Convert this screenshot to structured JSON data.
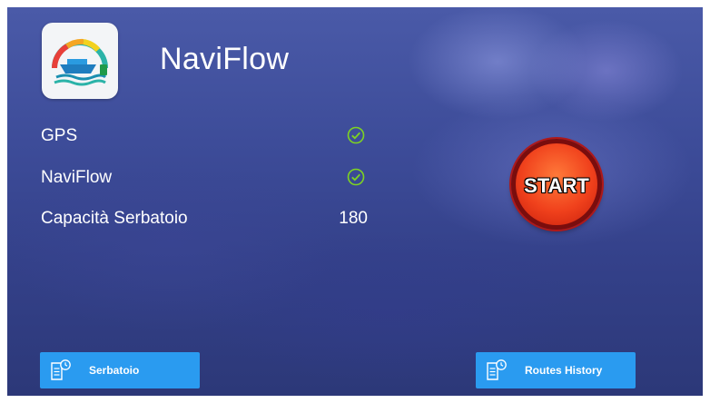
{
  "app": {
    "title": "NaviFlow",
    "icon": "boat-fuel-gauge-icon"
  },
  "status_rows": [
    {
      "label": "GPS",
      "status": "ok",
      "icon": "check-circle-icon"
    },
    {
      "label": "NaviFlow",
      "status": "ok",
      "icon": "check-circle-icon"
    },
    {
      "label": "Capacità Serbatoio",
      "value": "180"
    }
  ],
  "start_button": {
    "label": "START"
  },
  "bottom_buttons": [
    {
      "label": "Serbatoio",
      "icon": "document-clock-icon"
    },
    {
      "label": "Routes History",
      "icon": "document-clock-icon"
    }
  ],
  "colors": {
    "accent_blue": "#2a9bf0",
    "check_green": "#7ed321",
    "start_red": "#f0411c"
  }
}
